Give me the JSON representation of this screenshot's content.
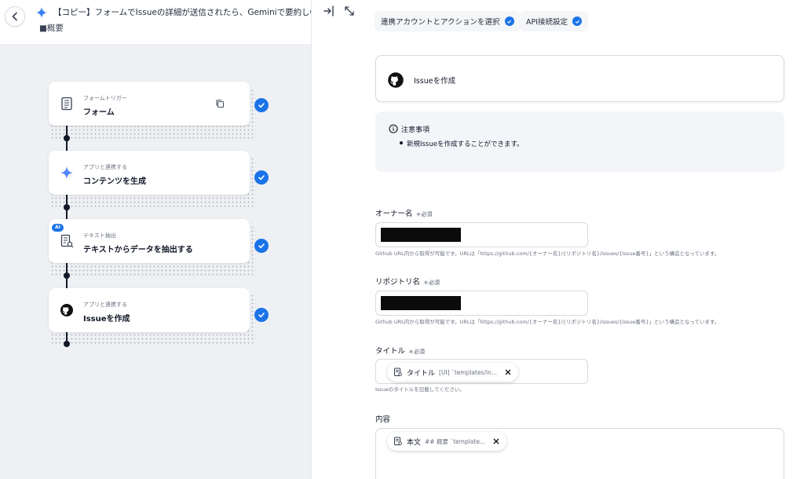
{
  "header": {
    "title": "【コピー】フォームでIssueの詳細が送信されたら、Geminiで要約しGitHubでIs",
    "subtitle": "■概要"
  },
  "nodes": [
    {
      "sub": "フォームトリガー",
      "label": "フォーム",
      "icon": "form-icon"
    },
    {
      "sub": "アプリと連携する",
      "label": "コンテンツを生成",
      "icon": "gemini-icon"
    },
    {
      "sub": "テキスト抽出",
      "label": "テキストからデータを抽出する",
      "icon": "text-extract-icon",
      "badge": "AI"
    },
    {
      "sub": "アプリと連携する",
      "label": "Issueを作成",
      "icon": "github-icon"
    }
  ],
  "tabs": [
    {
      "label": "連携アカウントとアクションを選択"
    },
    {
      "label": "API接続設定"
    }
  ],
  "action": {
    "label": "Issueを作成"
  },
  "notice": {
    "title": "注意事項",
    "items": [
      "新規Issueを作成することができます。"
    ]
  },
  "fields": {
    "owner": {
      "label": "オーナー名",
      "required": "＊必須",
      "help": "Github URL内から取得が可能です。URLは「https://github.com/{オーナー名}/{リポジトリ名}/issues/{Issue番号}」という構造となっています。"
    },
    "repo": {
      "label": "リポジトリ名",
      "required": "＊必須",
      "help": "Github URL内から取得が可能です。URLは「https://github.com/{オーナー名}/{リポジトリ名}/issues/{Issue番号}」という構造となっています。"
    },
    "title": {
      "label": "タイトル",
      "required": "＊必須",
      "chip_label": "タイトル",
      "chip_path": "[UI] `templates/in...",
      "help": "Issueのタイトルを記載してください。"
    },
    "content": {
      "label": "内容",
      "chip_label": "本文",
      "chip_path": "## 概要 `template..."
    }
  },
  "colors": {
    "accent": "#1a73e8",
    "canvas": "#eef0f3"
  }
}
